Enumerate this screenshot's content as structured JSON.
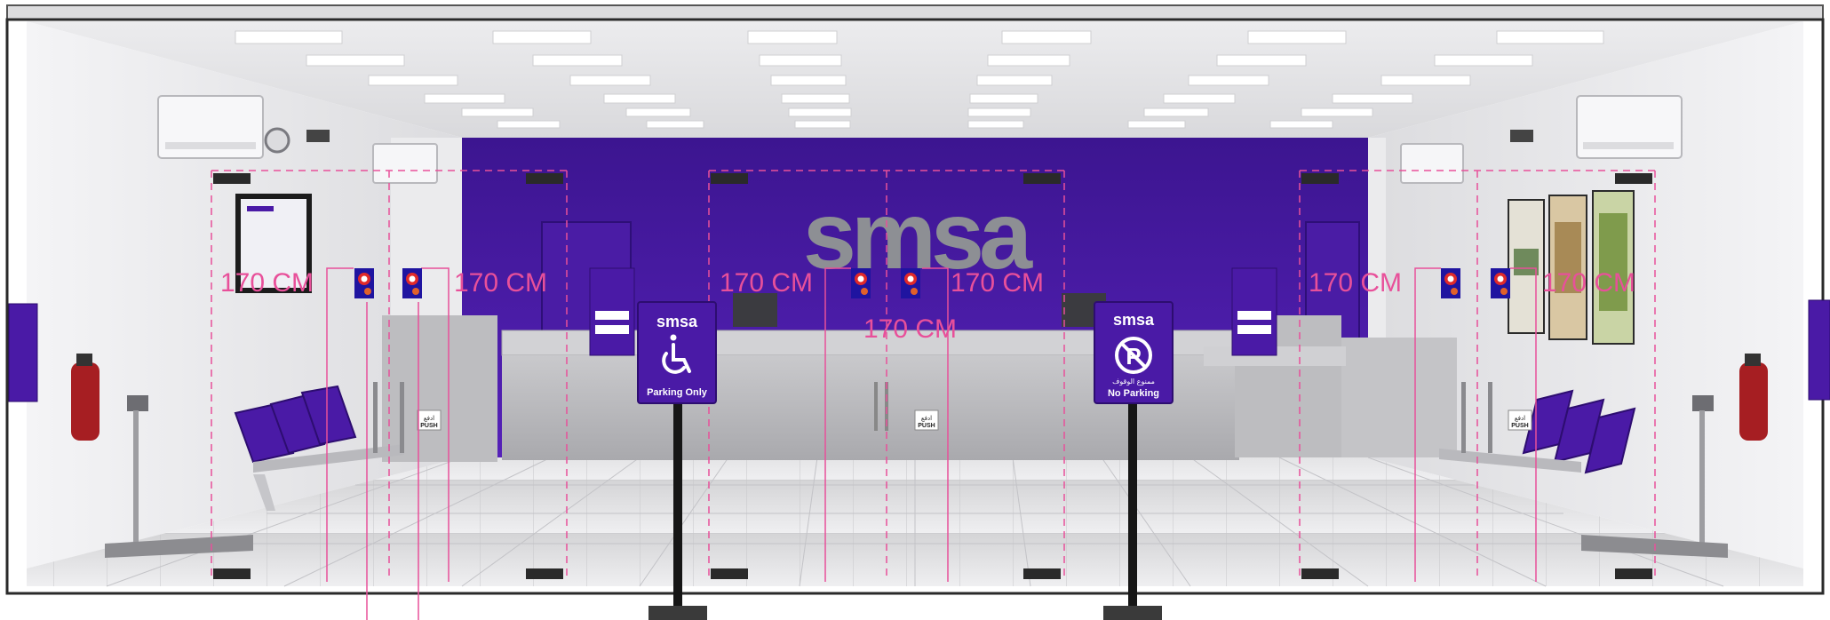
{
  "brand": {
    "logo_text": "smsa",
    "purple": "#4a1aa6",
    "grey": "#9a9a9a"
  },
  "measurement": {
    "color": "#e8509a",
    "labels": [
      "170 CM",
      "170 CM",
      "170 CM",
      "170 CM",
      "170 CM",
      "170 CM",
      "170 CM"
    ]
  },
  "signs": {
    "accessible": {
      "logo": "smsa",
      "icon": "wheelchair-icon",
      "caption": "Parking Only"
    },
    "no_parking": {
      "logo": "smsa",
      "icon": "no-parking-icon",
      "arabic": "ممنوع الوقوف",
      "caption": "No Parking"
    }
  },
  "door_stickers": {
    "arabic": "ادفع",
    "english": "PUSH"
  }
}
